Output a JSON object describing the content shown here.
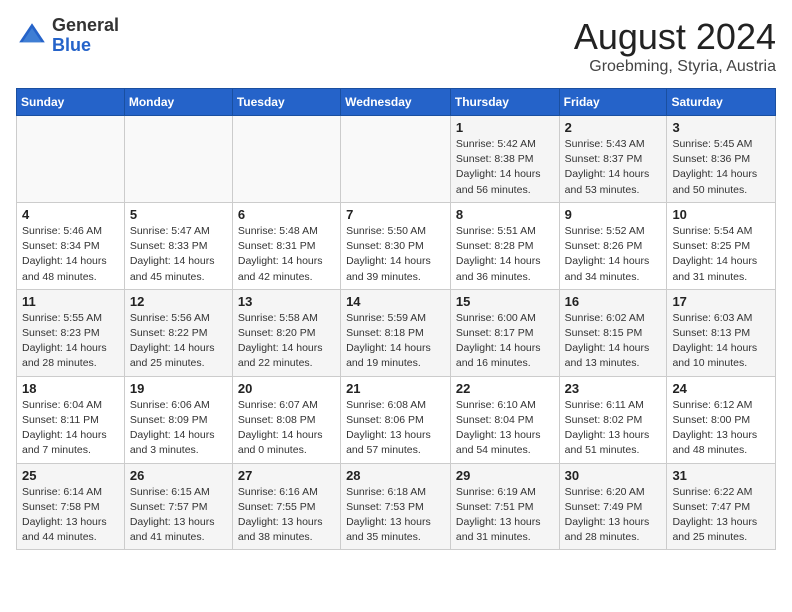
{
  "logo": {
    "general": "General",
    "blue": "Blue"
  },
  "header": {
    "title": "August 2024",
    "subtitle": "Groebming, Styria, Austria"
  },
  "weekdays": [
    "Sunday",
    "Monday",
    "Tuesday",
    "Wednesday",
    "Thursday",
    "Friday",
    "Saturday"
  ],
  "weeks": [
    [
      {
        "day": "",
        "info": ""
      },
      {
        "day": "",
        "info": ""
      },
      {
        "day": "",
        "info": ""
      },
      {
        "day": "",
        "info": ""
      },
      {
        "day": "1",
        "info": "Sunrise: 5:42 AM\nSunset: 8:38 PM\nDaylight: 14 hours\nand 56 minutes."
      },
      {
        "day": "2",
        "info": "Sunrise: 5:43 AM\nSunset: 8:37 PM\nDaylight: 14 hours\nand 53 minutes."
      },
      {
        "day": "3",
        "info": "Sunrise: 5:45 AM\nSunset: 8:36 PM\nDaylight: 14 hours\nand 50 minutes."
      }
    ],
    [
      {
        "day": "4",
        "info": "Sunrise: 5:46 AM\nSunset: 8:34 PM\nDaylight: 14 hours\nand 48 minutes."
      },
      {
        "day": "5",
        "info": "Sunrise: 5:47 AM\nSunset: 8:33 PM\nDaylight: 14 hours\nand 45 minutes."
      },
      {
        "day": "6",
        "info": "Sunrise: 5:48 AM\nSunset: 8:31 PM\nDaylight: 14 hours\nand 42 minutes."
      },
      {
        "day": "7",
        "info": "Sunrise: 5:50 AM\nSunset: 8:30 PM\nDaylight: 14 hours\nand 39 minutes."
      },
      {
        "day": "8",
        "info": "Sunrise: 5:51 AM\nSunset: 8:28 PM\nDaylight: 14 hours\nand 36 minutes."
      },
      {
        "day": "9",
        "info": "Sunrise: 5:52 AM\nSunset: 8:26 PM\nDaylight: 14 hours\nand 34 minutes."
      },
      {
        "day": "10",
        "info": "Sunrise: 5:54 AM\nSunset: 8:25 PM\nDaylight: 14 hours\nand 31 minutes."
      }
    ],
    [
      {
        "day": "11",
        "info": "Sunrise: 5:55 AM\nSunset: 8:23 PM\nDaylight: 14 hours\nand 28 minutes."
      },
      {
        "day": "12",
        "info": "Sunrise: 5:56 AM\nSunset: 8:22 PM\nDaylight: 14 hours\nand 25 minutes."
      },
      {
        "day": "13",
        "info": "Sunrise: 5:58 AM\nSunset: 8:20 PM\nDaylight: 14 hours\nand 22 minutes."
      },
      {
        "day": "14",
        "info": "Sunrise: 5:59 AM\nSunset: 8:18 PM\nDaylight: 14 hours\nand 19 minutes."
      },
      {
        "day": "15",
        "info": "Sunrise: 6:00 AM\nSunset: 8:17 PM\nDaylight: 14 hours\nand 16 minutes."
      },
      {
        "day": "16",
        "info": "Sunrise: 6:02 AM\nSunset: 8:15 PM\nDaylight: 14 hours\nand 13 minutes."
      },
      {
        "day": "17",
        "info": "Sunrise: 6:03 AM\nSunset: 8:13 PM\nDaylight: 14 hours\nand 10 minutes."
      }
    ],
    [
      {
        "day": "18",
        "info": "Sunrise: 6:04 AM\nSunset: 8:11 PM\nDaylight: 14 hours\nand 7 minutes."
      },
      {
        "day": "19",
        "info": "Sunrise: 6:06 AM\nSunset: 8:09 PM\nDaylight: 14 hours\nand 3 minutes."
      },
      {
        "day": "20",
        "info": "Sunrise: 6:07 AM\nSunset: 8:08 PM\nDaylight: 14 hours\nand 0 minutes."
      },
      {
        "day": "21",
        "info": "Sunrise: 6:08 AM\nSunset: 8:06 PM\nDaylight: 13 hours\nand 57 minutes."
      },
      {
        "day": "22",
        "info": "Sunrise: 6:10 AM\nSunset: 8:04 PM\nDaylight: 13 hours\nand 54 minutes."
      },
      {
        "day": "23",
        "info": "Sunrise: 6:11 AM\nSunset: 8:02 PM\nDaylight: 13 hours\nand 51 minutes."
      },
      {
        "day": "24",
        "info": "Sunrise: 6:12 AM\nSunset: 8:00 PM\nDaylight: 13 hours\nand 48 minutes."
      }
    ],
    [
      {
        "day": "25",
        "info": "Sunrise: 6:14 AM\nSunset: 7:58 PM\nDaylight: 13 hours\nand 44 minutes."
      },
      {
        "day": "26",
        "info": "Sunrise: 6:15 AM\nSunset: 7:57 PM\nDaylight: 13 hours\nand 41 minutes."
      },
      {
        "day": "27",
        "info": "Sunrise: 6:16 AM\nSunset: 7:55 PM\nDaylight: 13 hours\nand 38 minutes."
      },
      {
        "day": "28",
        "info": "Sunrise: 6:18 AM\nSunset: 7:53 PM\nDaylight: 13 hours\nand 35 minutes."
      },
      {
        "day": "29",
        "info": "Sunrise: 6:19 AM\nSunset: 7:51 PM\nDaylight: 13 hours\nand 31 minutes."
      },
      {
        "day": "30",
        "info": "Sunrise: 6:20 AM\nSunset: 7:49 PM\nDaylight: 13 hours\nand 28 minutes."
      },
      {
        "day": "31",
        "info": "Sunrise: 6:22 AM\nSunset: 7:47 PM\nDaylight: 13 hours\nand 25 minutes."
      }
    ]
  ]
}
